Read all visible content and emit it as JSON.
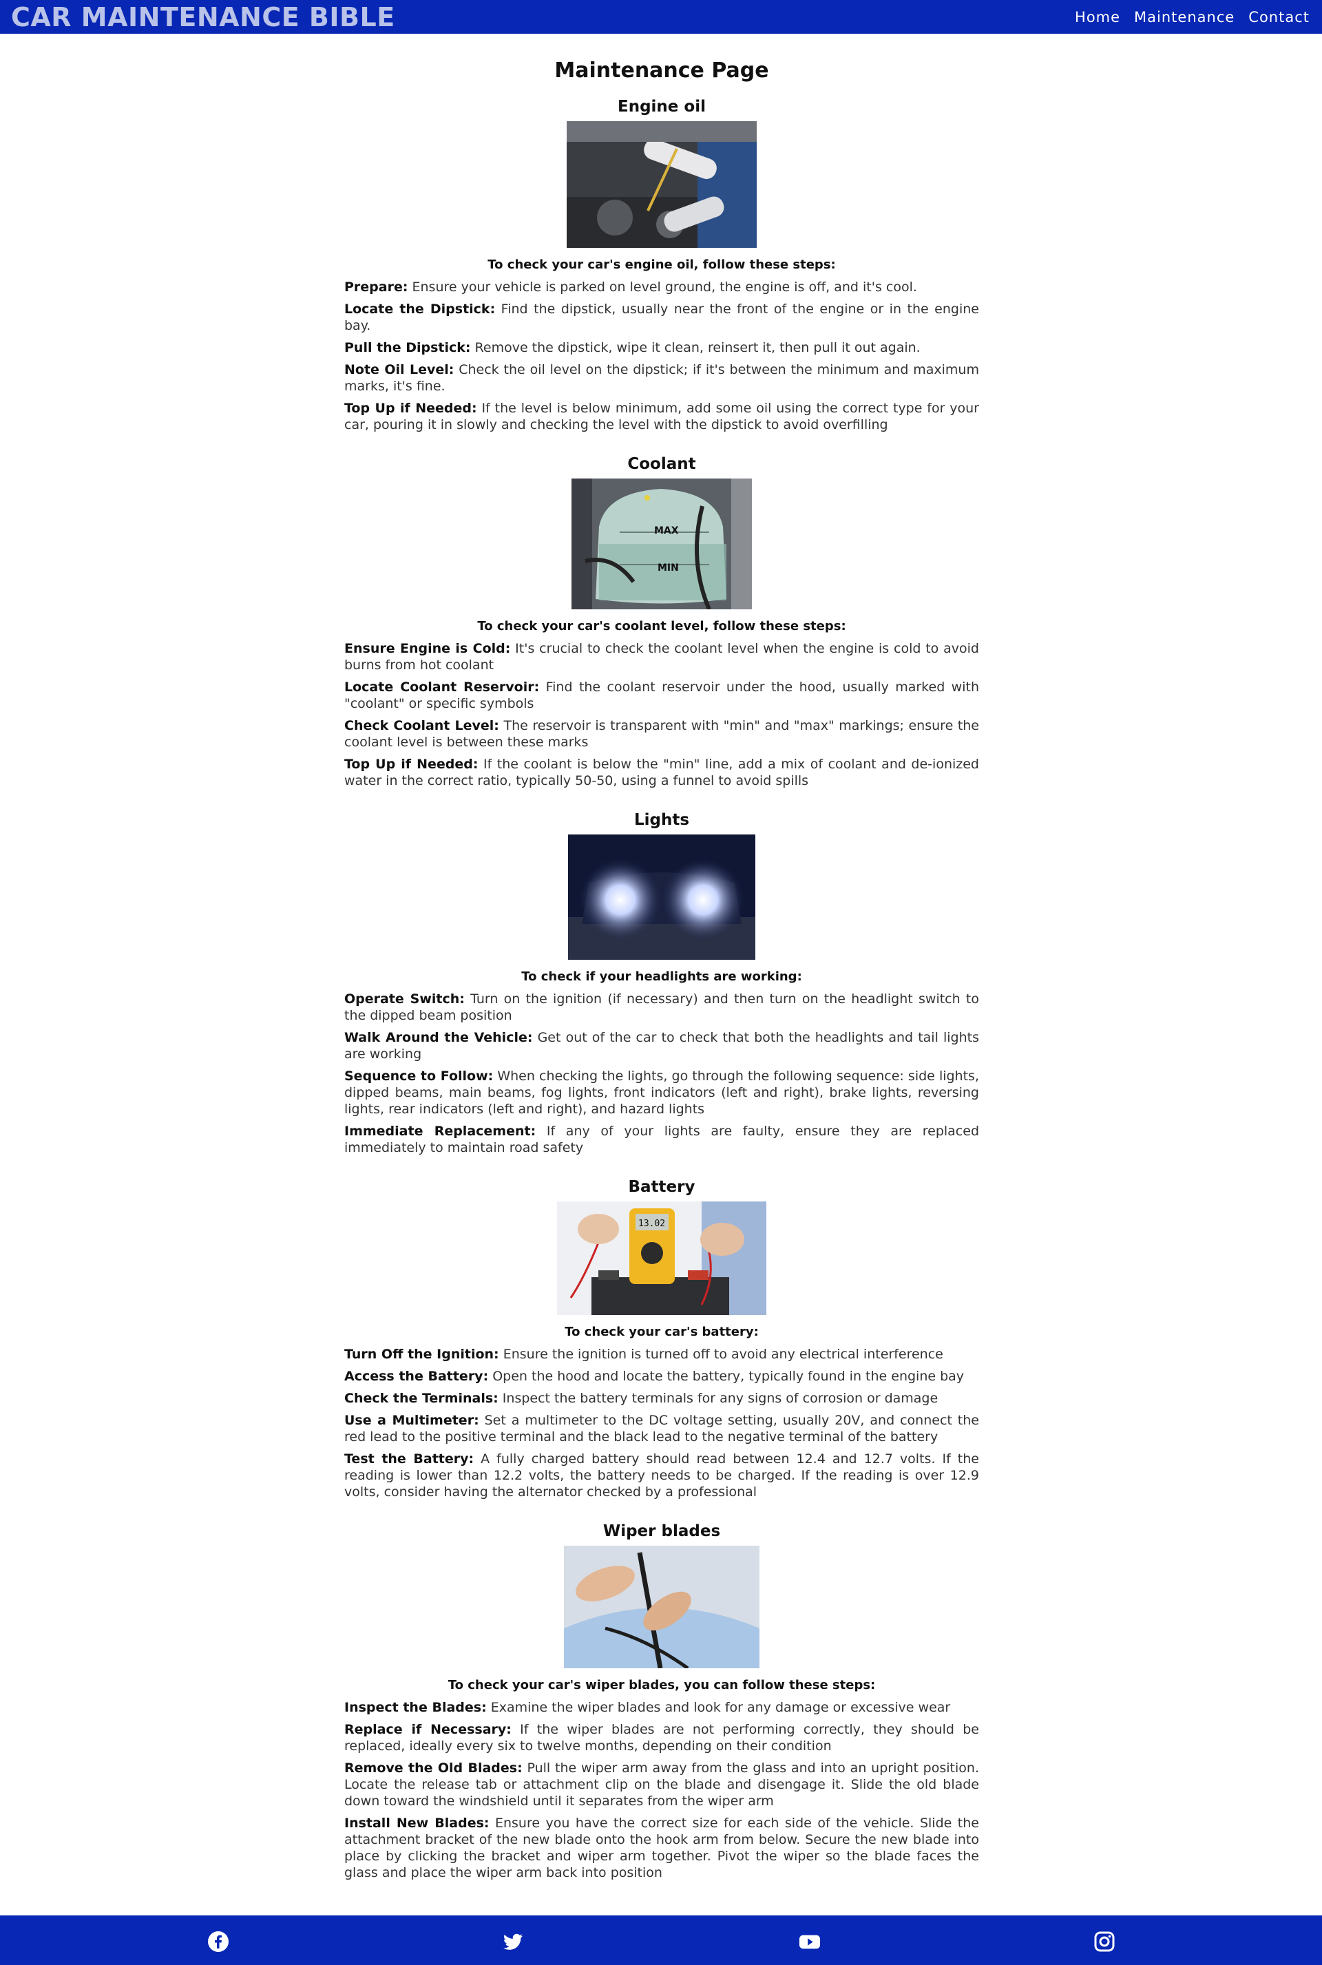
{
  "header": {
    "logo": "CAR MAINTENANCE BIBLE",
    "nav": [
      "Home",
      "Maintenance",
      "Contact"
    ]
  },
  "page_title": "Maintenance Page",
  "sections": [
    {
      "title": "Engine oil",
      "image": "engine-oil-photo",
      "intro": "To check your car's engine oil, follow these steps:",
      "steps": [
        {
          "label": "Prepare:",
          "text": " Ensure your vehicle is parked on level ground, the engine is off, and it's cool."
        },
        {
          "label": "Locate the Dipstick:",
          "text": " Find the dipstick, usually near the front of the engine or in the engine bay."
        },
        {
          "label": "Pull the Dipstick:",
          "text": " Remove the dipstick, wipe it clean, reinsert it, then pull it out again."
        },
        {
          "label": "Note Oil Level:",
          "text": " Check the oil level on the dipstick; if it's between the minimum and maximum marks, it's fine."
        },
        {
          "label": "Top Up if Needed:",
          "text": " If the level is below minimum, add some oil using the correct type for your car, pouring it in slowly and checking the level with the dipstick to avoid overfilling"
        }
      ]
    },
    {
      "title": "Coolant",
      "image": "coolant-reservoir-photo",
      "image_text": {
        "max": "MAX",
        "min": "MIN"
      },
      "intro": "To check your car's coolant level, follow these steps:",
      "steps": [
        {
          "label": "Ensure Engine is Cold:",
          "text": " It's crucial to check the coolant level when the engine is cold to avoid burns from hot coolant"
        },
        {
          "label": "Locate Coolant Reservoir:",
          "text": " Find the coolant reservoir under the hood, usually marked with \"coolant\" or specific symbols"
        },
        {
          "label": "Check Coolant Level:",
          "text": " The reservoir is transparent with \"min\" and \"max\" markings; ensure the coolant level is between these marks"
        },
        {
          "label": "Top Up if Needed:",
          "text": " If the coolant is below the \"min\" line, add a mix of coolant and de-ionized water in the correct ratio, typically 50-50, using a funnel to avoid spills"
        }
      ]
    },
    {
      "title": "Lights",
      "image": "headlights-photo",
      "intro": "To check if your headlights are working:",
      "steps": [
        {
          "label": "Operate Switch:",
          "text": " Turn on the ignition (if necessary) and then turn on the headlight switch to the dipped beam position"
        },
        {
          "label": "Walk Around the Vehicle:",
          "text": " Get out of the car to check that both the headlights and tail lights are working"
        },
        {
          "label": "Sequence to Follow:",
          "text": " When checking the lights, go through the following sequence: side lights, dipped beams, main beams, fog lights, front indicators (left and right), brake lights, reversing lights, rear indicators (left and right), and hazard lights"
        },
        {
          "label": "Immediate Replacement:",
          "text": " If any of your lights are faulty, ensure they are replaced immediately to maintain road safety"
        }
      ]
    },
    {
      "title": "Battery",
      "image": "battery-multimeter-photo",
      "image_text": {
        "display": "13.02"
      },
      "intro": "To check your car's battery:",
      "steps": [
        {
          "label": "Turn Off the Ignition:",
          "text": " Ensure the ignition is turned off to avoid any electrical interference"
        },
        {
          "label": "Access the Battery:",
          "text": " Open the hood and locate the battery, typically found in the engine bay"
        },
        {
          "label": "Check the Terminals:",
          "text": " Inspect the battery terminals for any signs of corrosion or damage"
        },
        {
          "label": "Use a Multimeter:",
          "text": " Set a multimeter to the DC voltage setting, usually 20V, and connect the red lead to the positive terminal and the black lead to the negative terminal of the battery"
        },
        {
          "label": "Test the Battery:",
          "text": " A fully charged battery should read between 12.4 and 12.7 volts. If the reading is lower than 12.2 volts, the battery needs to be charged. If the reading is over 12.9 volts, consider having the alternator checked by a professional"
        }
      ]
    },
    {
      "title": "Wiper blades",
      "image": "wiper-blades-photo",
      "intro": "To check your car's wiper blades, you can follow these steps:",
      "steps": [
        {
          "label": "Inspect the Blades:",
          "text": " Examine the wiper blades and look for any damage or excessive wear"
        },
        {
          "label": "Replace if Necessary:",
          "text": " If the wiper blades are not performing correctly, they should be replaced, ideally every six to twelve months, depending on their condition"
        },
        {
          "label": "Remove the Old Blades:",
          "text": " Pull the wiper arm away from the glass and into an upright position. Locate the release tab or attachment clip on the blade and disengage it. Slide the old blade down toward the windshield until it separates from the wiper arm"
        },
        {
          "label": "Install New Blades:",
          "text": " Ensure you have the correct size for each side of the vehicle. Slide the attachment bracket of the new blade onto the hook arm from below. Secure the new blade into place by clicking the bracket and wiper arm together. Pivot the wiper so the blade faces the glass and place the wiper arm back into position"
        }
      ]
    }
  ],
  "footer": {
    "icons": [
      "facebook-icon",
      "twitter-icon",
      "youtube-icon",
      "instagram-icon"
    ]
  },
  "colors": {
    "brand": "#0727b4",
    "logo": "#b9c2e8"
  }
}
